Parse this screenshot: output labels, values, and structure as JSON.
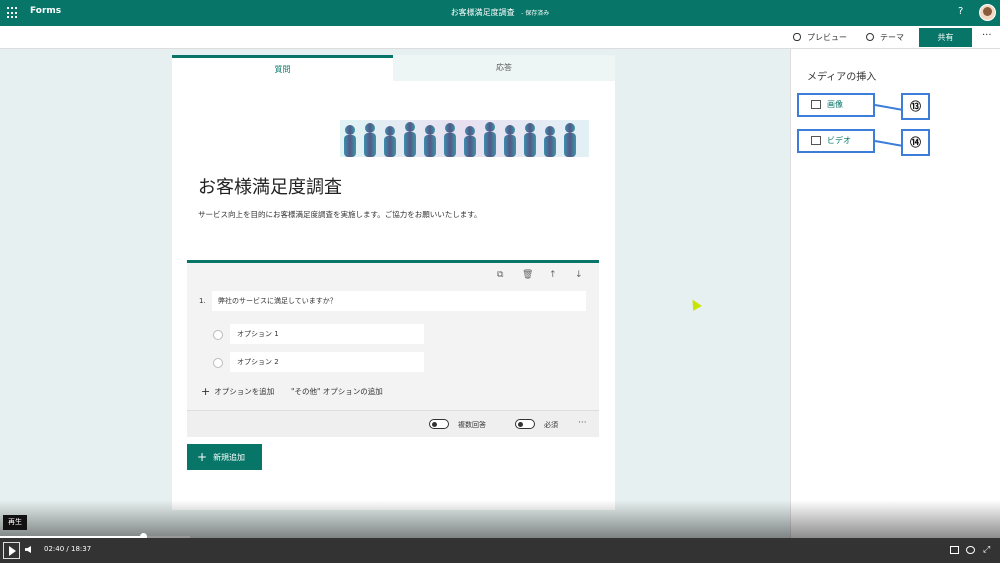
{
  "topbar": {
    "app_name": "Forms",
    "doc_title": "お客様満足度調査",
    "saved_status": "- 保存済み",
    "help": "?"
  },
  "commandbar": {
    "preview": "プレビュー",
    "theme": "テーマ",
    "share": "共有",
    "more": "···"
  },
  "tabs": {
    "questions": "質問",
    "responses": "応答"
  },
  "form": {
    "title": "お客様満足度調査",
    "description": "サービス向上を目的にお客様満足度調査を実施します。ご協力をお願いいたします。"
  },
  "question": {
    "number": "1.",
    "text": "弊社のサービスに満足していますか？",
    "options": [
      "オプション 1",
      "オプション 2"
    ],
    "add_option": "オプションを追加",
    "add_other": "\"その他\" オプションの追加",
    "multiple_answers": "複数回答",
    "required": "必須",
    "more": "···"
  },
  "new_button": "新規追加",
  "side_panel": {
    "title": "メディアの挿入",
    "image_label": "画像",
    "video_label": "ビデオ",
    "callout_image": "⑬",
    "callout_video": "⑭"
  },
  "player": {
    "tooltip": "再生",
    "current_time": "02:40",
    "separator": "/",
    "total_time": "18:37",
    "progress": 0.143
  },
  "colors": {
    "accent": "#077568",
    "callout": "#3b7dd8"
  }
}
